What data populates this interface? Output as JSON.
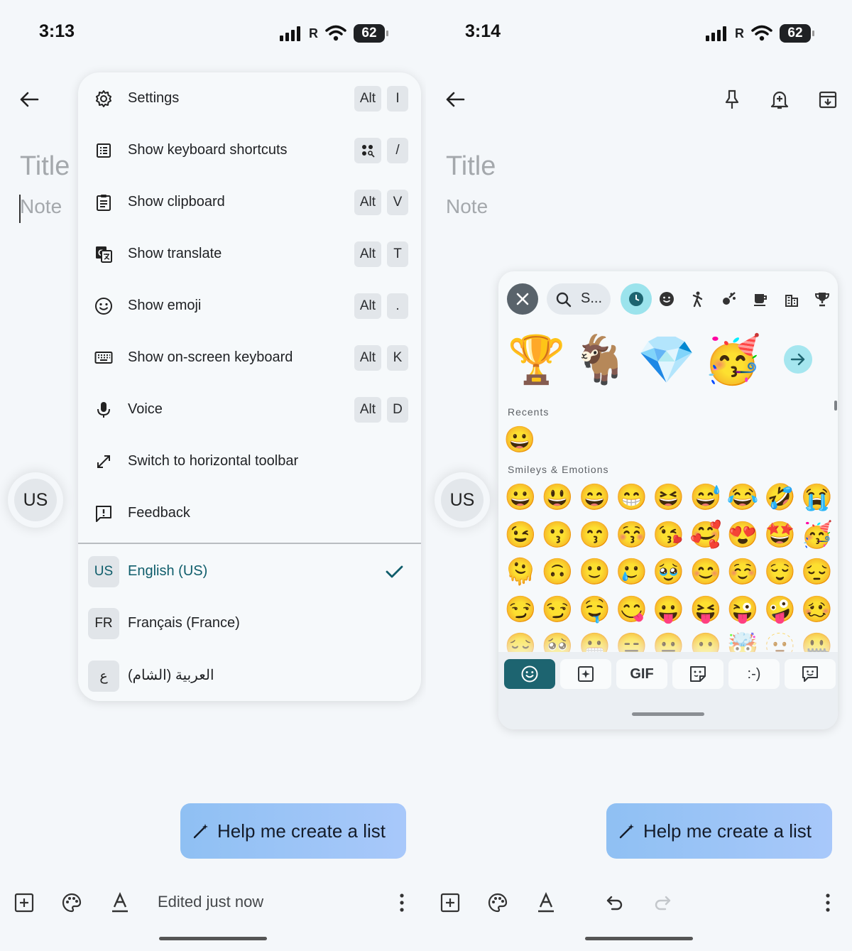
{
  "left": {
    "status": {
      "time": "3:13",
      "carrier": "R",
      "battery": "62"
    },
    "note": {
      "title_placeholder": "Title",
      "body_placeholder": "Note"
    },
    "menu": {
      "items": [
        {
          "label": "Settings",
          "icon": "gear-icon",
          "keys": [
            "Alt",
            "I"
          ]
        },
        {
          "label": "Show keyboard shortcuts",
          "icon": "list-icon",
          "keys": [
            "launcher",
            "/"
          ]
        },
        {
          "label": "Show clipboard",
          "icon": "clipboard-icon",
          "keys": [
            "Alt",
            "V"
          ]
        },
        {
          "label": "Show translate",
          "icon": "translate-icon",
          "keys": [
            "Alt",
            "T"
          ]
        },
        {
          "label": "Show emoji",
          "icon": "smiley-icon",
          "keys": [
            "Alt",
            "."
          ]
        },
        {
          "label": "Show on-screen keyboard",
          "icon": "keyboard-icon",
          "keys": [
            "Alt",
            "K"
          ]
        },
        {
          "label": "Voice",
          "icon": "mic-icon",
          "keys": [
            "Alt",
            "D"
          ]
        },
        {
          "label": "Switch to horizontal toolbar",
          "icon": "diagonal-arrows-icon",
          "keys": []
        },
        {
          "label": "Feedback",
          "icon": "feedback-icon",
          "keys": []
        }
      ],
      "languages": [
        {
          "tag": "US",
          "label": "English (US)",
          "selected": true
        },
        {
          "tag": "FR",
          "label": "Français (France)",
          "selected": false
        },
        {
          "tag": "ع",
          "label": "العربية (الشام)",
          "selected": false
        }
      ]
    },
    "us_bubble": "US",
    "help_button": "Help me create a list",
    "edited_text": "Edited just now"
  },
  "right": {
    "status": {
      "time": "3:14",
      "carrier": "R",
      "battery": "62"
    },
    "note": {
      "title_placeholder": "Title",
      "body_placeholder": "Note"
    },
    "us_bubble": "US",
    "emoji_panel": {
      "search_text": "S...",
      "featured": [
        "🏆",
        "🐐",
        "💎",
        "🥳"
      ],
      "recents_label": "Recents",
      "recents": [
        "😀"
      ],
      "smileys_label": "Smileys & Emotions",
      "smileys": [
        "😀",
        "😃",
        "😄",
        "😁",
        "😆",
        "😅",
        "😂",
        "🤣",
        "😭",
        "😉",
        "😗",
        "😙",
        "😚",
        "😘",
        "🥰",
        "😍",
        "🤩",
        "🥳",
        "🫠",
        "🙃",
        "🙂",
        "🥲",
        "🥹",
        "😊",
        "☺️",
        "😌",
        "😔",
        "😏",
        "😏",
        "🤤",
        "😋",
        "😛",
        "😝",
        "😜",
        "🤪",
        "🥴",
        "😔",
        "🥺",
        "😬",
        "😑",
        "😐",
        "😶",
        "🤯",
        "🫥",
        "🤐"
      ],
      "tabs": [
        "emoji",
        "sticker",
        "GIF",
        "emoji-kitchen",
        ":-)",
        "chat"
      ]
    },
    "help_button": "Help me create a list"
  },
  "colors": {
    "accent_teal": "#1d6470",
    "help_gradient_start": "#8fc0f3",
    "selected_lang": "#0f5d6b"
  }
}
